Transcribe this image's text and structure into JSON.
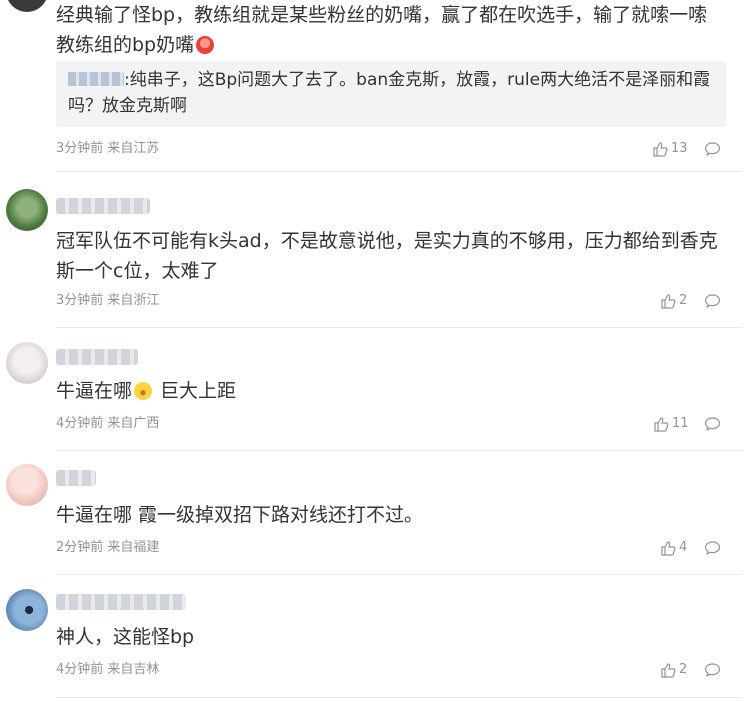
{
  "comments": [
    {
      "text": "经典输了怪bp，教练组就是某些粉丝的奶嘴，赢了都在吹选手，输了就嗦一嗦教练组的bp奶嘴",
      "emoji": "face-icon",
      "reply": {
        "text": ":纯串子，这Bp问题大了去了。ban金克斯，放霞，rule两大绝活不是泽丽和霞吗？放金克斯啊"
      },
      "time": "3分钟前",
      "location": "来自江苏",
      "likes": "13"
    },
    {
      "text": "冠军队伍不可能有k头ad，不是故意说他，是实力真的不够用，压力都给到香克斯一个c位，太难了",
      "time": "3分钟前",
      "location": "来自浙江",
      "likes": "2"
    },
    {
      "text_before": "牛逼在哪",
      "text_after": " 巨大上距",
      "emoji": "surprised-face-icon",
      "time": "4分钟前",
      "location": "来自广西",
      "likes": "11"
    },
    {
      "text": "牛逼在哪 霞一级掉双招下路对线还打不过。",
      "time": "2分钟前",
      "location": "来自福建",
      "likes": "4"
    },
    {
      "text": "神人，这能怪bp",
      "time": "4分钟前",
      "location": "来自吉林",
      "likes": "2"
    }
  ],
  "colors": {
    "meta": "#939393",
    "text": "#333333",
    "reply_bg": "#f2f3f5",
    "divider": "#e8e8e8"
  }
}
